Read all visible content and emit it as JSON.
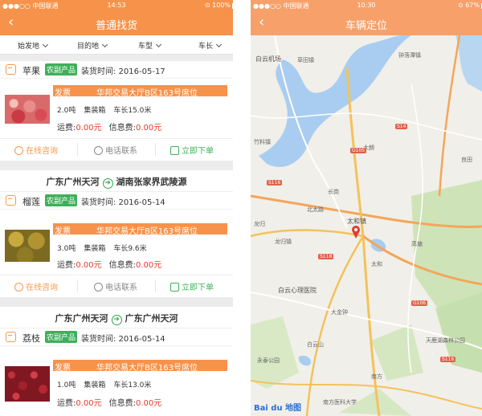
{
  "left_screen": {
    "status": {
      "carrier": "●●●○○ 中国联通 ",
      "time": "14:53",
      "right": "⊙ 100%",
      "battery_level": 1.0
    },
    "nav": {
      "back": "‹",
      "title": "普通找货"
    },
    "filters": [
      "始发地",
      "目的地",
      "车型",
      "车长"
    ],
    "cards": [
      {
        "route": null,
        "cargo": "苹果",
        "tag": "农副产品",
        "date": "装货时间: 2016-05-17",
        "fp_label": "发票",
        "location": "华邦交易大厅B区163号席位",
        "weight": "2.0吨",
        "vehicle": "集装箱",
        "length": "车长15.0米",
        "freight_label": "运费:",
        "freight": "0.00元",
        "info_label": "信息费:",
        "info": "0.00元",
        "photo": "apple"
      },
      {
        "route": {
          "from": "广东广州天河",
          "to": "湖南张家界武陵源"
        },
        "cargo": "榴莲",
        "tag": "农副产品",
        "date": "装货时间: 2016-05-14",
        "fp_label": "发票",
        "location": "华邦交易大厅B区163号席位",
        "weight": "3.0吨",
        "vehicle": "集装箱",
        "length": "车长9.6米",
        "freight_label": "运费:",
        "freight": "0.00元",
        "info_label": "信息费:",
        "info": "0.00元",
        "photo": "durian"
      },
      {
        "route": {
          "from": "广东广州天河",
          "to": "广东广州天河"
        },
        "cargo": "荔枝",
        "tag": "农副产品",
        "date": "装货时间: 2016-05-14",
        "fp_label": "发票",
        "location": "华邦交易大厅B区163号席位",
        "weight": "1.0吨",
        "vehicle": "集装箱",
        "length": "车长13.0米",
        "freight_label": "运费:",
        "freight": "0.00元",
        "info_label": "信息费:",
        "info": "0.00元",
        "photo": "lychee"
      }
    ],
    "actions": {
      "consult": "在线咨询",
      "phone": "电话联系",
      "order": "立即下单"
    }
  },
  "right_screen": {
    "status": {
      "carrier": "●●●○○ 中国联通 ",
      "time": "10:30",
      "right": "⊙ 67%",
      "battery_level": 0.67
    },
    "nav": {
      "back": "‹",
      "title": "车辆定位"
    },
    "map_labels": {
      "airport": "白云机场",
      "a": "草田镇",
      "b": "钟落潭镇",
      "c": "太和镇",
      "d": "北太路",
      "e": "长岗",
      "f": "白云心理医院",
      "g": "大金钟",
      "h": "白云山",
      "i": "天鹿湖森林公园",
      "j": "南方医科大学",
      "k": "永泰公园",
      "l": "龙归",
      "m": "高塘",
      "n": "大朗",
      "o": "竹料镇",
      "p": "良田",
      "q": "龙归镇",
      "r": "太和",
      "s": "南方"
    },
    "road_shields": [
      "S116",
      "G105",
      "S14",
      "S118",
      "G106",
      "S116"
    ],
    "baidu": "Bai du 地图"
  },
  "colors": {
    "accent": "#f7924a",
    "green": "#3fb05a",
    "red": "#e53a2e"
  }
}
